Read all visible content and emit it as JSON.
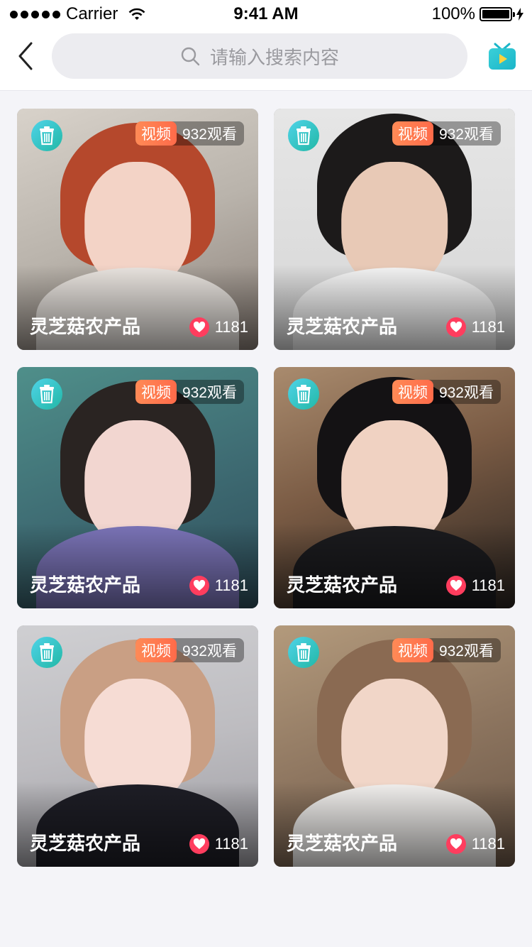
{
  "status_bar": {
    "carrier": "Carrier",
    "time": "9:41 AM",
    "battery": "100%"
  },
  "nav": {
    "search_placeholder": "请输入搜索内容"
  },
  "colors": {
    "accent": "#ff6b4a",
    "trash": "#22b8a6",
    "heart": "#ff3d5e",
    "tv_icon": "#29c3d6"
  },
  "cards": [
    {
      "type_label": "视频",
      "views": "932观看",
      "title": "灵芝菇农产品",
      "likes": "1181"
    },
    {
      "type_label": "视频",
      "views": "932观看",
      "title": "灵芝菇农产品",
      "likes": "1181"
    },
    {
      "type_label": "视频",
      "views": "932观看",
      "title": "灵芝菇农产品",
      "likes": "1181"
    },
    {
      "type_label": "视频",
      "views": "932观看",
      "title": "灵芝菇农产品",
      "likes": "1181"
    },
    {
      "type_label": "视频",
      "views": "932观看",
      "title": "灵芝菇农产品",
      "likes": "1181"
    },
    {
      "type_label": "视频",
      "views": "932观看",
      "title": "灵芝菇农产品",
      "likes": "1181"
    }
  ]
}
